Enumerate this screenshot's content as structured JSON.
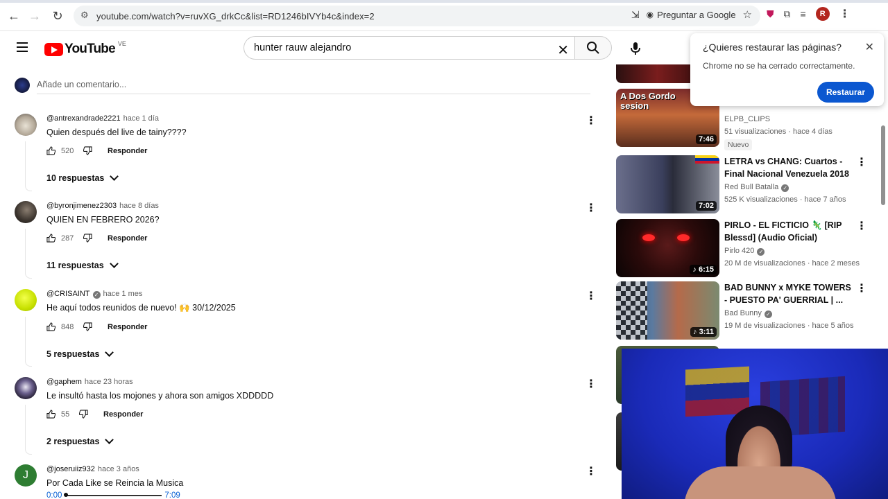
{
  "browser": {
    "url": "youtube.com/watch?v=ruvXG_drkCc&list=RD1246bIVYb4c&index=2",
    "ask_google": "Preguntar a Google",
    "profile_initial": "R"
  },
  "header": {
    "logo_word": "YouTube",
    "country": "VE",
    "search_query": "hunter rauw alejandro"
  },
  "comments_section": {
    "add_comment_placeholder": "Añade un comentario...",
    "reply_label": "Responder",
    "comments": [
      {
        "user": "@antrexandrade2221",
        "time": "hace 1 día",
        "text": "Quien después del live de tainy????",
        "likes": "520",
        "replies": "10 respuestas"
      },
      {
        "user": "@byronjimenez2303",
        "time": "hace 8 días",
        "text": "QUIEN EN FEBRERO 2026?",
        "likes": "287",
        "replies": "11 respuestas"
      },
      {
        "user": "@CRISAINT",
        "time": "hace 1 mes",
        "text": "He aquí todos reunidos de nuevo! 🙌 30/12/2025",
        "likes": "848",
        "replies": "5 respuestas"
      },
      {
        "user": "@gaphem",
        "time": "hace 23 horas",
        "text": "Le insultó hasta los mojones y ahora son amigos XDDDDD",
        "likes": "55",
        "replies": "2 respuestas"
      },
      {
        "user": "@joseruiiz932",
        "time": "hace 3 años",
        "text": "Por Cada Like se Reincia la Musica",
        "avatar_letter": "J",
        "progress_start": "0:00",
        "progress_end": "7:09"
      }
    ]
  },
  "sidebar": {
    "videos": [
      {
        "duration": "7:46",
        "thumb_text": "A Dos Gordo sesion",
        "title": "",
        "channel": "ELPB_CLIPS",
        "meta": "51 visualizaciones · hace 4 días",
        "badge": "Nuevo"
      },
      {
        "duration": "7:02",
        "title": "LETRA vs CHANG: Cuartos - Final Nacional Venezuela 2018",
        "channel": "Red Bull Batalla",
        "meta": "525 K visualizaciones · hace 7 años"
      },
      {
        "duration": "6:15",
        "title": "PIRLO - EL FICTICIO 🦎 [RIP Blessd] (Audio Oficial)",
        "channel": "Pirlo 420",
        "meta": "20 M de visualizaciones · hace 2 meses"
      },
      {
        "duration": "3:11",
        "title": "BAD BUNNY x MYKE TOWERS - PUESTO PA' GUERRIAL | ...",
        "channel": "Bad Bunny",
        "meta": "19 M de visualizaciones · hace 5 años"
      }
    ]
  },
  "restore_popup": {
    "title": "¿Quieres restaurar las páginas?",
    "message": "Chrome no se ha cerrado correctamente.",
    "button": "Restaurar"
  },
  "colors": {
    "brand_red": "#ff0000",
    "link_blue": "#065fd4",
    "restore_blue": "#0b57d0"
  }
}
